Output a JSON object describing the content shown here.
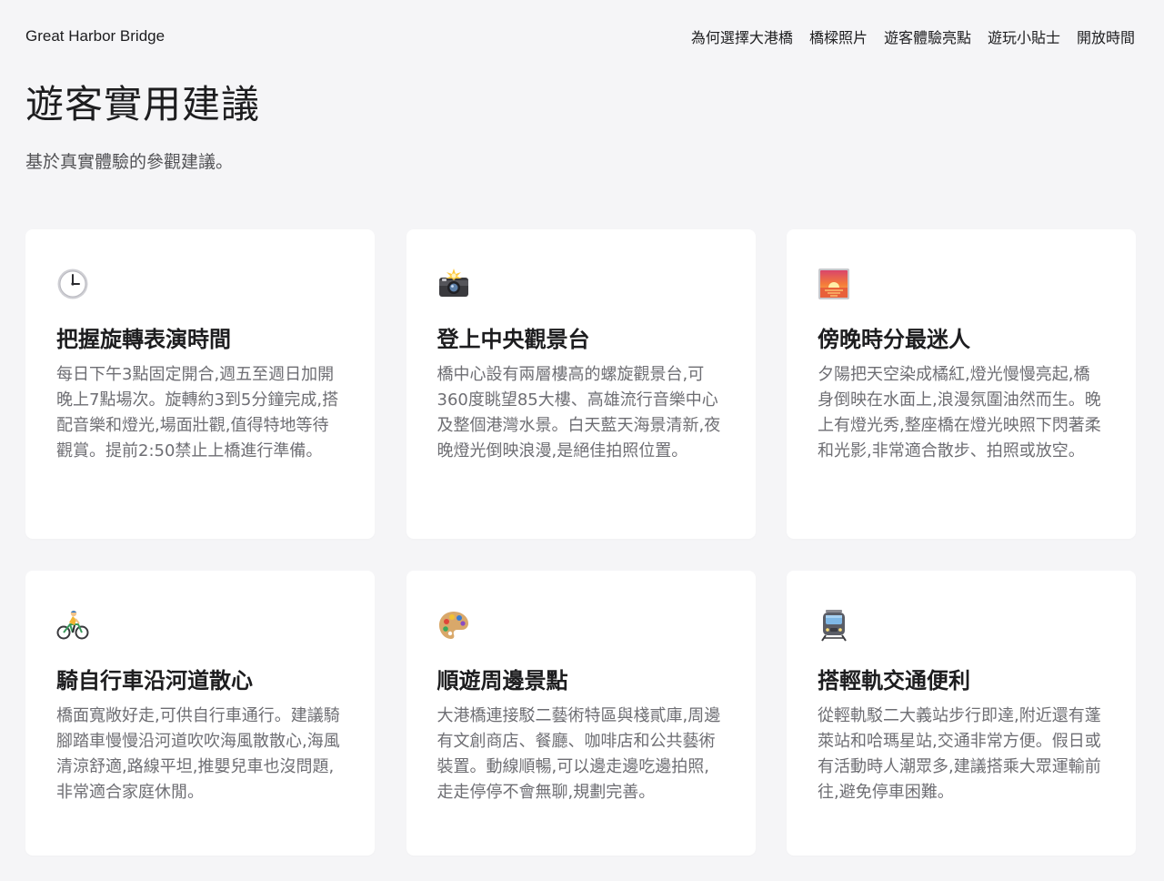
{
  "nav": {
    "brand": "Great Harbor Bridge",
    "links": [
      "為何選擇大港橋",
      "橋樑照片",
      "遊客體驗亮點",
      "遊玩小貼士",
      "開放時間"
    ]
  },
  "hero": {
    "title": "遊客實用建議",
    "subtitle": "基於真實體驗的參觀建議。"
  },
  "cards": [
    {
      "icon": "clock-icon",
      "title": "把握旋轉表演時間",
      "desc": "每日下午3點固定開合,週五至週日加開晚上7點場次。旋轉約3到5分鐘完成,搭配音樂和燈光,場面壯觀,值得特地等待觀賞。提前2:50禁止上橋進行準備。"
    },
    {
      "icon": "camera-flash-icon",
      "title": "登上中央觀景台",
      "desc": "橋中心設有兩層樓高的螺旋觀景台,可360度眺望85大樓、高雄流行音樂中心及整個港灣水景。白天藍天海景清新,夜晚燈光倒映浪漫,是絕佳拍照位置。"
    },
    {
      "icon": "sunset-icon",
      "title": "傍晚時分最迷人",
      "desc": "夕陽把天空染成橘紅,燈光慢慢亮起,橋身倒映在水面上,浪漫氛圍油然而生。晚上有燈光秀,整座橋在燈光映照下閃著柔和光影,非常適合散步、拍照或放空。"
    },
    {
      "icon": "cyclist-icon",
      "title": "騎自行車沿河道散心",
      "desc": "橋面寬敞好走,可供自行車通行。建議騎腳踏車慢慢沿河道吹吹海風散散心,海風清涼舒適,路線平坦,推嬰兒車也沒問題,非常適合家庭休閒。"
    },
    {
      "icon": "palette-icon",
      "title": "順遊周邊景點",
      "desc": "大港橋連接駁二藝術特區與棧貳庫,周邊有文創商店、餐廳、咖啡店和公共藝術裝置。動線順暢,可以邊走邊吃邊拍照,走走停停不會無聊,規劃完善。"
    },
    {
      "icon": "tram-icon",
      "title": "搭輕軌交通便利",
      "desc": "從輕軌駁二大義站步行即達,附近還有蓬萊站和哈瑪星站,交通非常方便。假日或有活動時人潮眾多,建議搭乘大眾運輸前往,避免停車困難。"
    }
  ]
}
